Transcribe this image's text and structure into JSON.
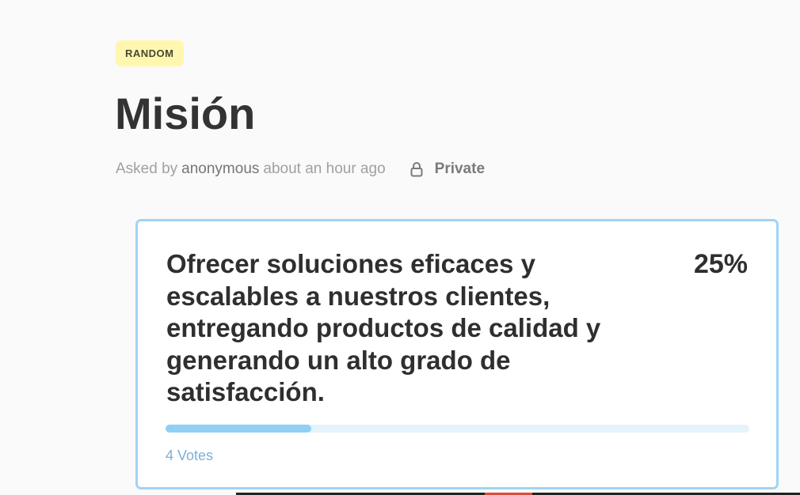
{
  "category": {
    "label": "RANDOM"
  },
  "question": {
    "title": "Misión",
    "meta": {
      "prefix": "Asked by",
      "author": "anonymous",
      "time": "about an hour ago",
      "privacy_icon": "lock-icon",
      "privacy": "Private"
    }
  },
  "options": [
    {
      "text": "Ofrecer soluciones eficaces y escalables a nuestros clientes, entregando productos de calidad y generando un alto grado de satisfacción.",
      "percent_label": "25%",
      "percent_value": 25,
      "votes": "4 Votes"
    }
  ],
  "colors": {
    "tag_bg": "#fff7b0",
    "card_border": "#9fd4f3",
    "bar_fill": "#8fd0f4",
    "bar_track": "#e5f3fc",
    "votes_text": "#7fb0d4"
  }
}
